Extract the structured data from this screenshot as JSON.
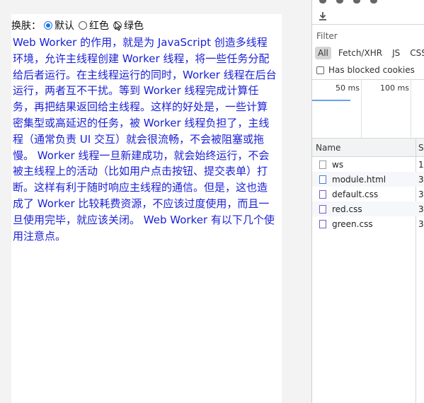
{
  "page": {
    "theme": {
      "label": "换肤：",
      "options": [
        "默认",
        "红色",
        "绿色"
      ],
      "selected": "默认"
    },
    "article": "Web Worker 的作用，就是为 JavaScript 创造多线程环境，允许主线程创建 Worker 线程，将一些任务分配给后者运行。在主线程运行的同时，Worker 线程在后台运行，两者互不干扰。等到 Worker 线程完成计算任务，再把结果返回给主线程。这样的好处是，一些计算密集型或高延迟的任务，被 Worker 线程负担了，主线程（通常负责 UI 交互）就会很流畅，不会被阻塞或拖慢。 Worker 线程一旦新建成功，就会始终运行，不会被主线程上的活动（比如用户点击按钮、提交表单）打断。这样有利于随时响应主线程的通信。但是，这也造成了 Worker 比较耗费资源，不应该过度使用，而且一旦使用完毕，就应该关闭。 Web Worker 有以下几个使用注意点。",
    "text_color": "#1c22d6"
  },
  "devtools": {
    "filter_placeholder": "Filter",
    "filter_chips": [
      "All",
      "Fetch/XHR",
      "JS",
      "CSS"
    ],
    "active_chip": "All",
    "blocked_cookies_label": "Has blocked cookies",
    "timeline_ticks": [
      "50 ms",
      "100 ms"
    ],
    "table": {
      "col_name": "Name",
      "col_status": "S"
    },
    "requests": [
      {
        "name": "ws",
        "status": "1",
        "icon": "file-icon"
      },
      {
        "name": "module.html",
        "status": "3",
        "icon": "html-file-icon"
      },
      {
        "name": "default.css",
        "status": "3",
        "icon": "css-file-icon"
      },
      {
        "name": "red.css",
        "status": "3",
        "icon": "css-file-icon"
      },
      {
        "name": "green.css",
        "status": "3",
        "icon": "css-file-icon"
      }
    ],
    "accent_color": "#6aa0e8"
  }
}
